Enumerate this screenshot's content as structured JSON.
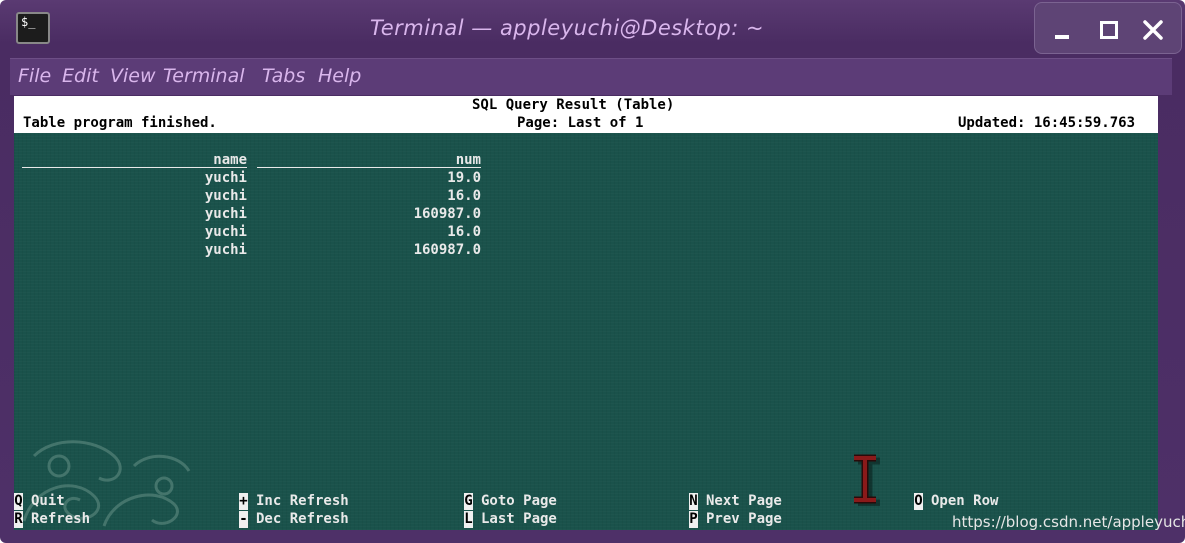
{
  "window": {
    "title": "Terminal — appleyuchi@Desktop: ~",
    "app_icon": "$_",
    "controls": [
      "minimize-icon",
      "maximize-icon",
      "close-icon"
    ]
  },
  "menu": [
    "File",
    "Edit",
    "View",
    "Terminal",
    "Tabs",
    "Help"
  ],
  "header": {
    "title": "SQL Query Result (Table)",
    "status": "Table program finished.",
    "page": "Page: Last of 1",
    "updated": "Updated: 16:45:59.763"
  },
  "table": {
    "columns": [
      "name",
      "num"
    ],
    "rows": [
      [
        "yuchi",
        "19.0"
      ],
      [
        "yuchi",
        "16.0"
      ],
      [
        "yuchi",
        "160987.0"
      ],
      [
        "yuchi",
        "16.0"
      ],
      [
        "yuchi",
        "160987.0"
      ]
    ]
  },
  "footer": [
    {
      "key": "Q",
      "label": "Quit"
    },
    {
      "key": "R",
      "label": "Refresh"
    },
    {
      "key": "+",
      "label": "Inc Refresh"
    },
    {
      "key": "-",
      "label": "Dec Refresh"
    },
    {
      "key": "G",
      "label": "Goto Page"
    },
    {
      "key": "L",
      "label": "Last Page"
    },
    {
      "key": "N",
      "label": "Next Page"
    },
    {
      "key": "P",
      "label": "Prev Page"
    },
    {
      "key": "O",
      "label": "Open Row"
    }
  ],
  "watermark": "https://blog.csdn.net/appleyuchi",
  "colors": {
    "window_bg": "#4e3068",
    "menu_text": "#d9b6ec",
    "terminal_bg": "#18504a",
    "cursor": "#8a1a1a"
  }
}
